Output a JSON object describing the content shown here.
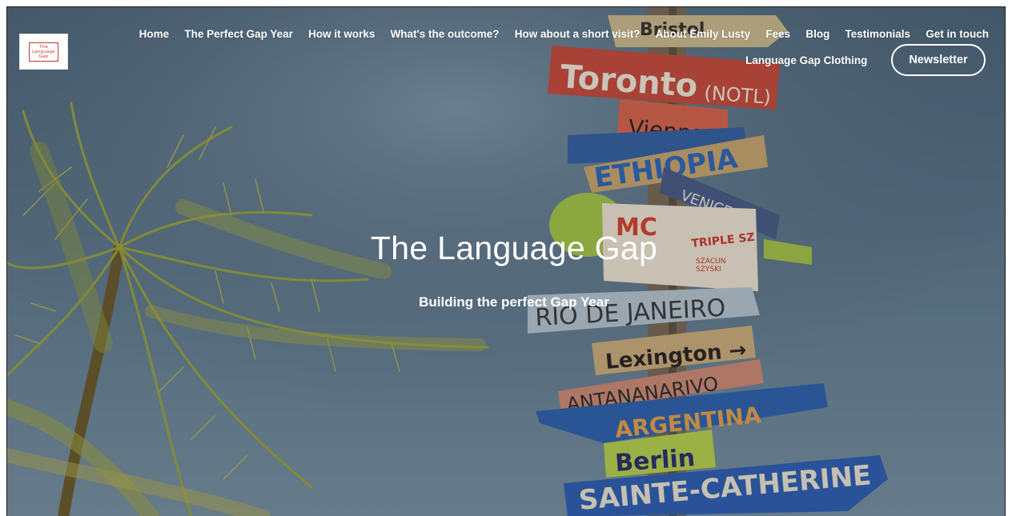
{
  "logo": {
    "line1": "The",
    "line2": "Language",
    "line3": "Gap"
  },
  "nav": {
    "items": [
      {
        "label": "Home"
      },
      {
        "label": "The Perfect Gap Year"
      },
      {
        "label": "How it works"
      },
      {
        "label": "What's the outcome?"
      },
      {
        "label": "How about a short visit?"
      },
      {
        "label": "About Emily Lusty"
      },
      {
        "label": "Fees"
      },
      {
        "label": "Blog"
      },
      {
        "label": "Testimonials"
      },
      {
        "label": "Get in touch"
      }
    ],
    "clothing_label": "Language Gap Clothing",
    "newsletter_label": "Newsletter"
  },
  "hero": {
    "title": "The Language Gap",
    "subtitle": "Building the perfect Gap Year",
    "sign_texts": [
      "Bristol",
      "Toronto (NOTL)",
      "Vienna",
      "ETHIOPIA",
      "VENICE",
      "TRIPLE SZ",
      "RIO DE JANEIRO",
      "Lexington",
      "ANTANANARIVO",
      "ARGENTINA",
      "Berlin",
      "SAINTE-CATHERINE"
    ]
  },
  "colors": {
    "sky": "#5a7386",
    "header_text": "#ffffff",
    "logo_accent": "#c0392b"
  }
}
